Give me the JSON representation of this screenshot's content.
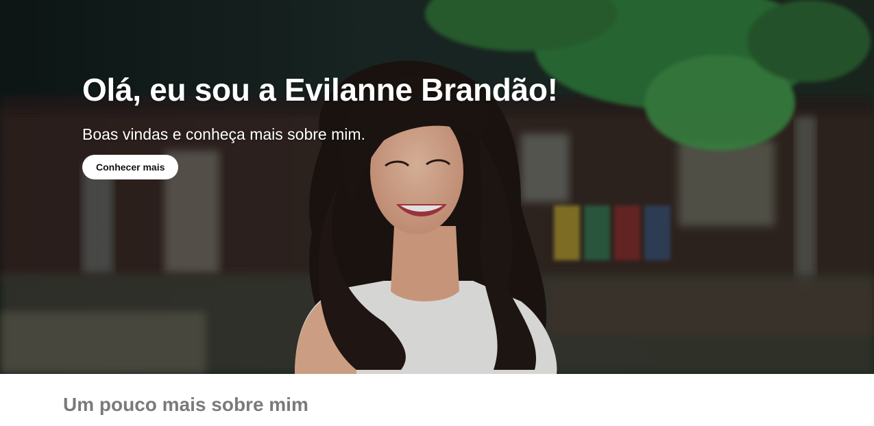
{
  "hero": {
    "title": "Olá, eu sou a Evilanne Brandão!",
    "subtitle": "Boas vindas e conheça mais sobre mim.",
    "button_label": "Conhecer mais"
  },
  "about": {
    "title": "Um pouco mais sobre mim"
  },
  "colors": {
    "accent_text": "#ffffff",
    "section_heading": "#7a7a7a",
    "button_bg": "#ffffff"
  }
}
